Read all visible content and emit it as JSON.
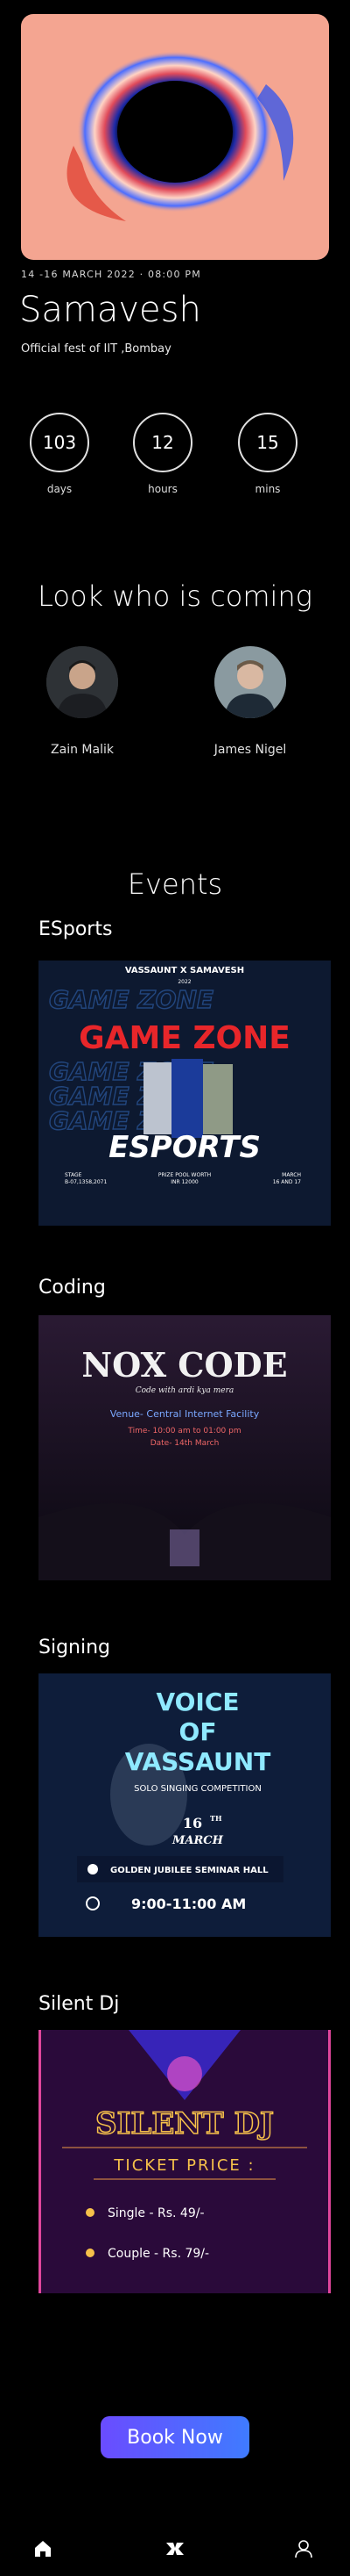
{
  "event": {
    "date_time": "14 -16 MARCH 2022 · 08:00 PM",
    "name": "Samavesh",
    "tagline": "Official fest of IIT ,Bombay"
  },
  "countdown": [
    {
      "value": "103",
      "unit": "days"
    },
    {
      "value": "12",
      "unit": "hours"
    },
    {
      "value": "15",
      "unit": "mins"
    }
  ],
  "guests": {
    "title": "Look who is coming",
    "people": [
      {
        "name": "Zain Malik"
      },
      {
        "name": "James Nigel"
      }
    ]
  },
  "events": {
    "title": "Events",
    "categories": [
      {
        "label": "ESports",
        "poster": {
          "banner": "VASSAUNT X SAMAVESH",
          "year": "2022",
          "headline": "GAME ZONE",
          "sub": "ESPORTS",
          "bg_text": "GAME ZONE",
          "left_info": "STAGE",
          "left_info2": "B-07,1358,2071",
          "center_info": "PRIZE POOL WORTH",
          "center_info2": "INR 12000",
          "right_info": "MARCH",
          "right_info2": "16 AND 17"
        }
      },
      {
        "label": "Coding",
        "poster": {
          "headline": "NOX CODE",
          "tagline": "Code with ardi kya mera",
          "venue": "Venue- Central Internet Facility",
          "time": "Time- 10:00 am to 01:00 pm",
          "date": "Date- 14th March"
        }
      },
      {
        "label": "Signing",
        "poster": {
          "line1": "VOICE",
          "line2": "OF",
          "line3": "VASSAUNT",
          "sub": "SOLO SINGING COMPETITION",
          "day": "16",
          "day_suffix": "TH",
          "month": "MARCH",
          "venue": "GOLDEN JUBILEE SEMINAR HALL",
          "time": "9:00-11:00 AM"
        }
      },
      {
        "label": "Silent Dj",
        "poster": {
          "headline": "SILENT DJ",
          "price_title": "TICKET PRICE :",
          "single": "Single - Rs. 49/-",
          "couple": "Couple - Rs. 79/-"
        }
      }
    ]
  },
  "cta": {
    "label": "Book Now"
  },
  "nav": {
    "items": [
      "home-icon",
      "logo-icon",
      "profile-icon"
    ]
  },
  "colors": {
    "accent_start": "#6a4cff",
    "accent_end": "#3f7bff",
    "hero_bg": "#f4a591"
  }
}
